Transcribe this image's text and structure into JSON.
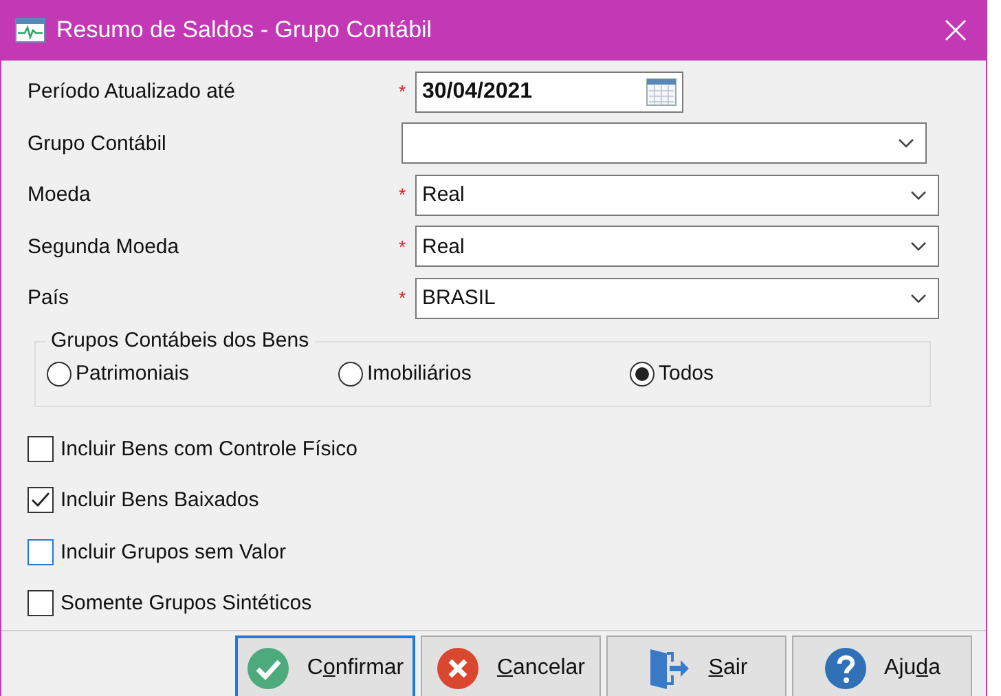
{
  "window": {
    "title": "Resumo de Saldos - Grupo Contábil"
  },
  "fields": [
    {
      "kind": "date",
      "label": "Período Atualizado até",
      "required_mark": "*",
      "value": "30/04/2021"
    },
    {
      "kind": "combo",
      "label": "Grupo Contábil"
    },
    {
      "kind": "combo",
      "label": "Moeda",
      "required_mark": "*",
      "value": "Real"
    },
    {
      "kind": "combo",
      "label": "Segunda Moeda",
      "required_mark": "*",
      "value": "Real"
    },
    {
      "kind": "combo",
      "label": "País",
      "required_mark": "*",
      "value": "BRASIL"
    }
  ],
  "group": {
    "title": "Grupos Contábeis dos Bens",
    "options": [
      {
        "label": "Patrimoniais",
        "selected": false
      },
      {
        "label": "Imobiliários",
        "selected": false
      },
      {
        "label": "Todos",
        "selected": true
      }
    ]
  },
  "checkboxes": [
    {
      "label": "Incluir Bens com Controle Físico",
      "checked": false,
      "focused": false
    },
    {
      "label": "Incluir Bens Baixados",
      "checked": true,
      "focused": false
    },
    {
      "label": "Incluir Grupos sem Valor",
      "checked": false,
      "focused": true
    },
    {
      "label": "Somente Grupos Sintéticos",
      "checked": false,
      "focused": false
    }
  ],
  "buttons": [
    {
      "kind": "confirm",
      "label_start": "C",
      "label_key": "o",
      "label_end": "nfirmar",
      "focused": true
    },
    {
      "kind": "cancel",
      "label_key": "C",
      "label_end": "ancelar",
      "focused": false
    },
    {
      "kind": "exit",
      "label_key": "S",
      "label_end": "air",
      "focused": false
    },
    {
      "kind": "help",
      "label_start": "Aju",
      "label_key": "d",
      "label_end": "a",
      "focused": false
    }
  ]
}
